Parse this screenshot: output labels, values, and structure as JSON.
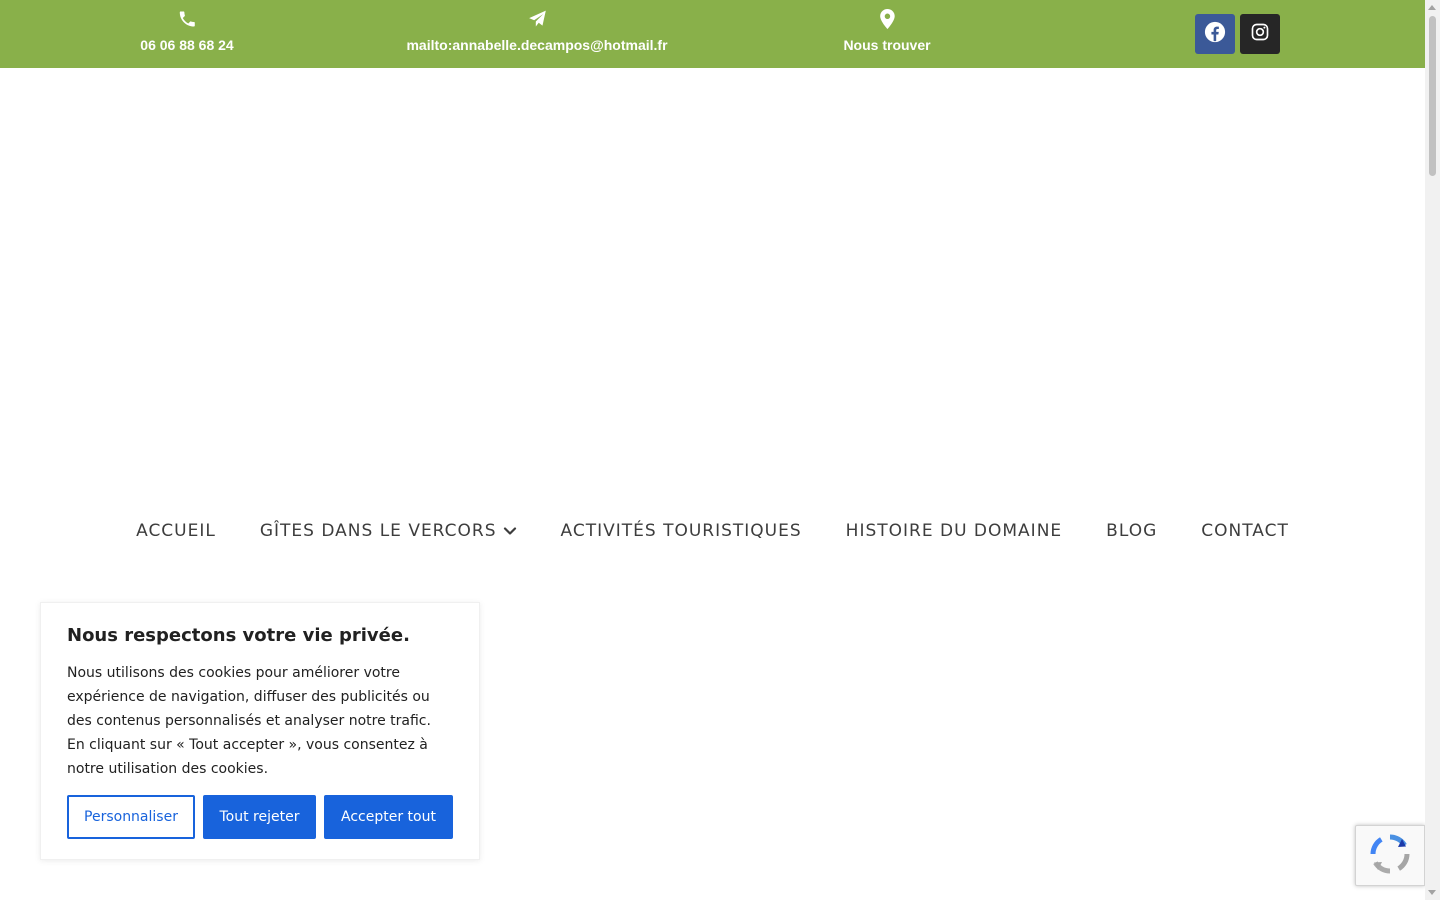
{
  "topbar": {
    "background": "#89b04a",
    "phone": {
      "icon": "phone-icon",
      "text": "06 06 88 68 24"
    },
    "email": {
      "icon": "paper-plane-icon",
      "text": "mailto:annabelle.decampos@hotmail.fr"
    },
    "location": {
      "icon": "map-marker-icon",
      "text": "Nous trouver"
    },
    "social": [
      {
        "name": "facebook",
        "icon": "facebook-icon",
        "color": "#3b5998"
      },
      {
        "name": "instagram",
        "icon": "instagram-icon",
        "color": "#262626"
      }
    ]
  },
  "nav": {
    "items": [
      {
        "label": "ACCUEIL"
      },
      {
        "label": "GÎTES DANS LE VERCORS",
        "has_dropdown": true
      },
      {
        "label": "ACTIVITÉS TOURISTIQUES"
      },
      {
        "label": "HISTOIRE DU DOMAINE"
      },
      {
        "label": "BLOG"
      },
      {
        "label": "CONTACT"
      }
    ]
  },
  "cookie_banner": {
    "title": "Nous respectons votre vie privée.",
    "body": "Nous utilisons des cookies pour améliorer votre expérience de navigation, diffuser des publicités ou des contenus personnalisés et analyser notre trafic. En cliquant sur « Tout accepter », vous consentez à notre utilisation des cookies.",
    "buttons": {
      "customize": "Personnaliser",
      "reject": "Tout rejeter",
      "accept": "Accepter tout"
    },
    "accent": "#1863dc"
  },
  "recaptcha": {
    "icon": "recaptcha-icon"
  }
}
